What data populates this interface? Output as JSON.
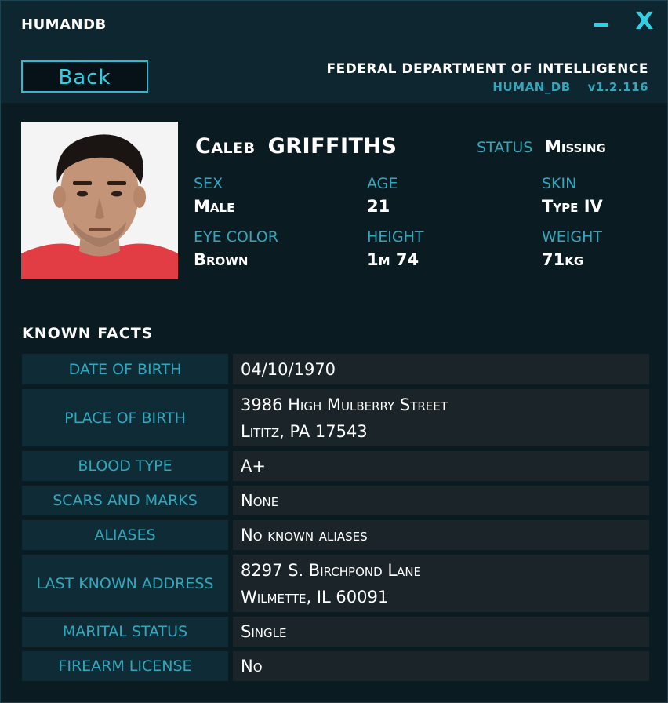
{
  "window": {
    "title": "HUMANDB",
    "minimize_icon": "minimize-icon",
    "close_symbol": "X"
  },
  "header": {
    "back_label": "Back",
    "department": "FEDERAL DEPARTMENT OF INTELLIGENCE",
    "db_name": "HUMAN_DB",
    "version": "v1.2.116"
  },
  "profile": {
    "first_name": "Caleb",
    "last_name": "GRIFFITHS",
    "status_label": "STATUS",
    "status_value": "Missing",
    "attributes": [
      {
        "label": "SEX",
        "value": "Male"
      },
      {
        "label": "AGE",
        "value": "21"
      },
      {
        "label": "SKIN",
        "value": "Type IV"
      },
      {
        "label": "EYE COLOR",
        "value": "Brown"
      },
      {
        "label": "HEIGHT",
        "value": "1m 74"
      },
      {
        "label": "WEIGHT",
        "value": "71kg"
      }
    ]
  },
  "facts": {
    "title": "KNOWN  FACTS",
    "rows": [
      {
        "label": "DATE OF BIRTH",
        "line1": "04/10/1970",
        "line2": ""
      },
      {
        "label": "PLACE OF BIRTH",
        "line1": "3986 High Mulberry Street",
        "line2": "Lititz, PA 17543"
      },
      {
        "label": "BLOOD TYPE",
        "line1": "A+",
        "line2": ""
      },
      {
        "label": "SCARS AND MARKS",
        "line1": "None",
        "line2": ""
      },
      {
        "label": "ALIASES",
        "line1": "No known aliases",
        "line2": ""
      },
      {
        "label": "LAST KNOWN ADDRESS",
        "line1": "8297 S. Birchpond Lane",
        "line2": "Wilmette, IL 60091"
      },
      {
        "label": "MARITAL STATUS",
        "line1": "Single",
        "line2": ""
      },
      {
        "label": "FIREARM LICENSE",
        "line1": "No",
        "line2": ""
      }
    ]
  },
  "colors": {
    "accent": "#2fd0e6",
    "label": "#2fa8be",
    "background": "#0a1b22"
  }
}
